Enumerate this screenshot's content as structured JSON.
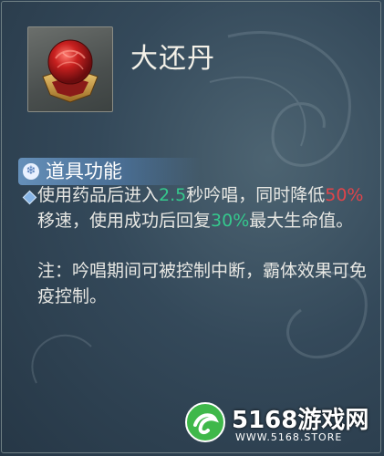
{
  "item": {
    "name": "大还丹",
    "icon": "red-pill-orb-icon"
  },
  "section": {
    "icon": "snowflake-icon",
    "title": "道具功能"
  },
  "description": {
    "p1": "使用药品后进入",
    "value_cast_seconds": "2.5",
    "p2": "秒吟唱，同时降低",
    "value_slow": "50%",
    "p3": "移速，使用成功后回复",
    "value_heal": "30%",
    "p4": "最大生命值。"
  },
  "note": "注：吟唱期间可被控制中断，霸体效果可免疫控制。",
  "watermark": {
    "title": "5168游戏网",
    "url": "WWW.5168.STORE"
  },
  "colors": {
    "highlight_green": "#35c88d",
    "highlight_red": "#e0444a",
    "watermark_green": "#3fb84a"
  }
}
